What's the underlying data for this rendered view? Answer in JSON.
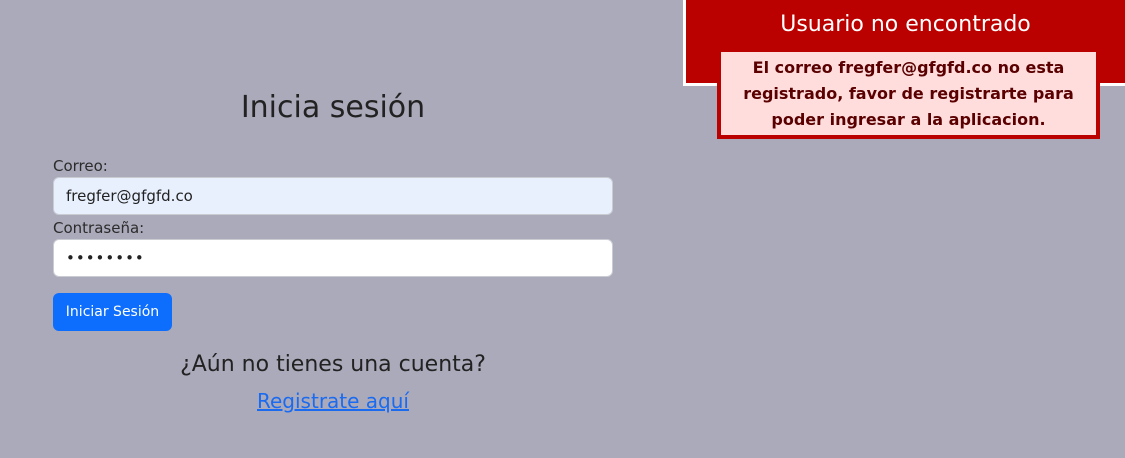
{
  "login": {
    "title": "Inicia sesión",
    "email_label": "Correo:",
    "email_value": "fregfer@gfgfd.co",
    "password_label": "Contraseña:",
    "password_value": "12345678",
    "submit_label": "Iniciar Sesión",
    "no_account_text": "¿Aún no tienes una cuenta?",
    "register_link": "Registrate aquí"
  },
  "alert": {
    "title": "Usuario no encontrado",
    "message": "El correo fregfer@gfgfd.co no esta registrado, favor de registrarte para poder ingresar a la aplicacion."
  },
  "colors": {
    "background": "#abaabb",
    "primary": "#0d6efd",
    "link": "#1a6bf0",
    "alert": "#bb0000",
    "alert_message_bg": "#ffdddd"
  }
}
